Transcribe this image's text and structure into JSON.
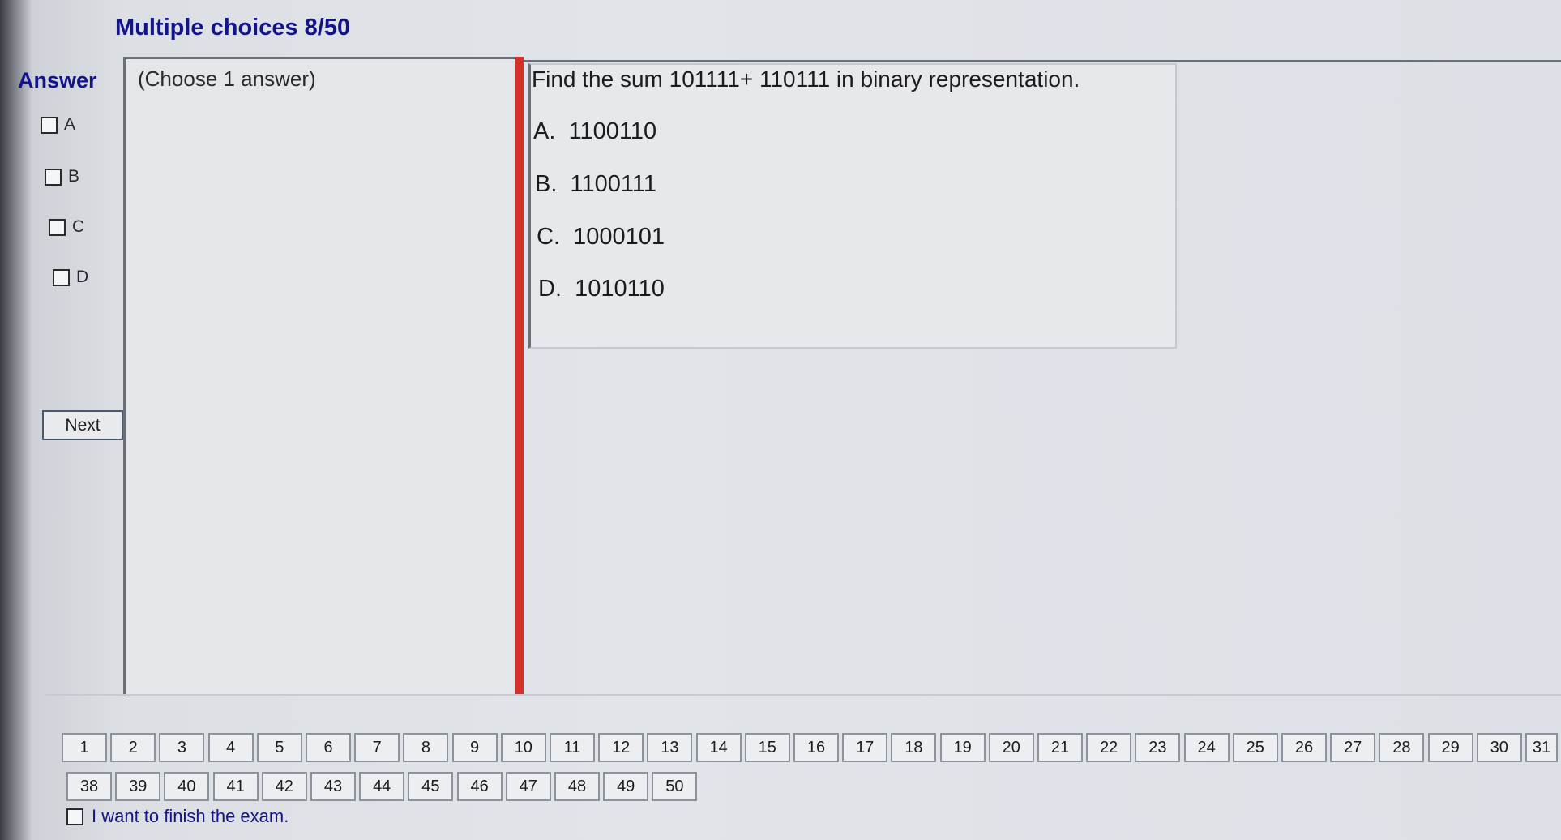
{
  "header": {
    "title": "Multiple choices 8/50"
  },
  "answer_panel": {
    "label": "Answer",
    "options": [
      "A",
      "B",
      "C",
      "D"
    ],
    "next_label": "Next"
  },
  "instructions": {
    "choose": "(Choose 1 answer)"
  },
  "question": {
    "text": "Find the sum 101111+ 110111  in binary representation.",
    "choices": [
      {
        "letter": "A.",
        "value": "1100110"
      },
      {
        "letter": "B.",
        "value": "1100111"
      },
      {
        "letter": "C.",
        "value": "1000101"
      },
      {
        "letter": "D.",
        "value": "1010110"
      }
    ]
  },
  "navigation": {
    "row1": [
      "1",
      "2",
      "3",
      "4",
      "5",
      "6",
      "7",
      "8",
      "9",
      "10",
      "11",
      "12",
      "13",
      "14",
      "15",
      "16",
      "17",
      "18",
      "19",
      "20",
      "21",
      "22",
      "23",
      "24",
      "25",
      "26",
      "27",
      "28",
      "29",
      "30",
      "31"
    ],
    "row2": [
      "38",
      "39",
      "40",
      "41",
      "42",
      "43",
      "44",
      "45",
      "46",
      "47",
      "48",
      "49",
      "50"
    ]
  },
  "finish": {
    "label": "I want to finish the exam."
  },
  "colors": {
    "accent": "#13138a",
    "divider": "#d7302b"
  }
}
